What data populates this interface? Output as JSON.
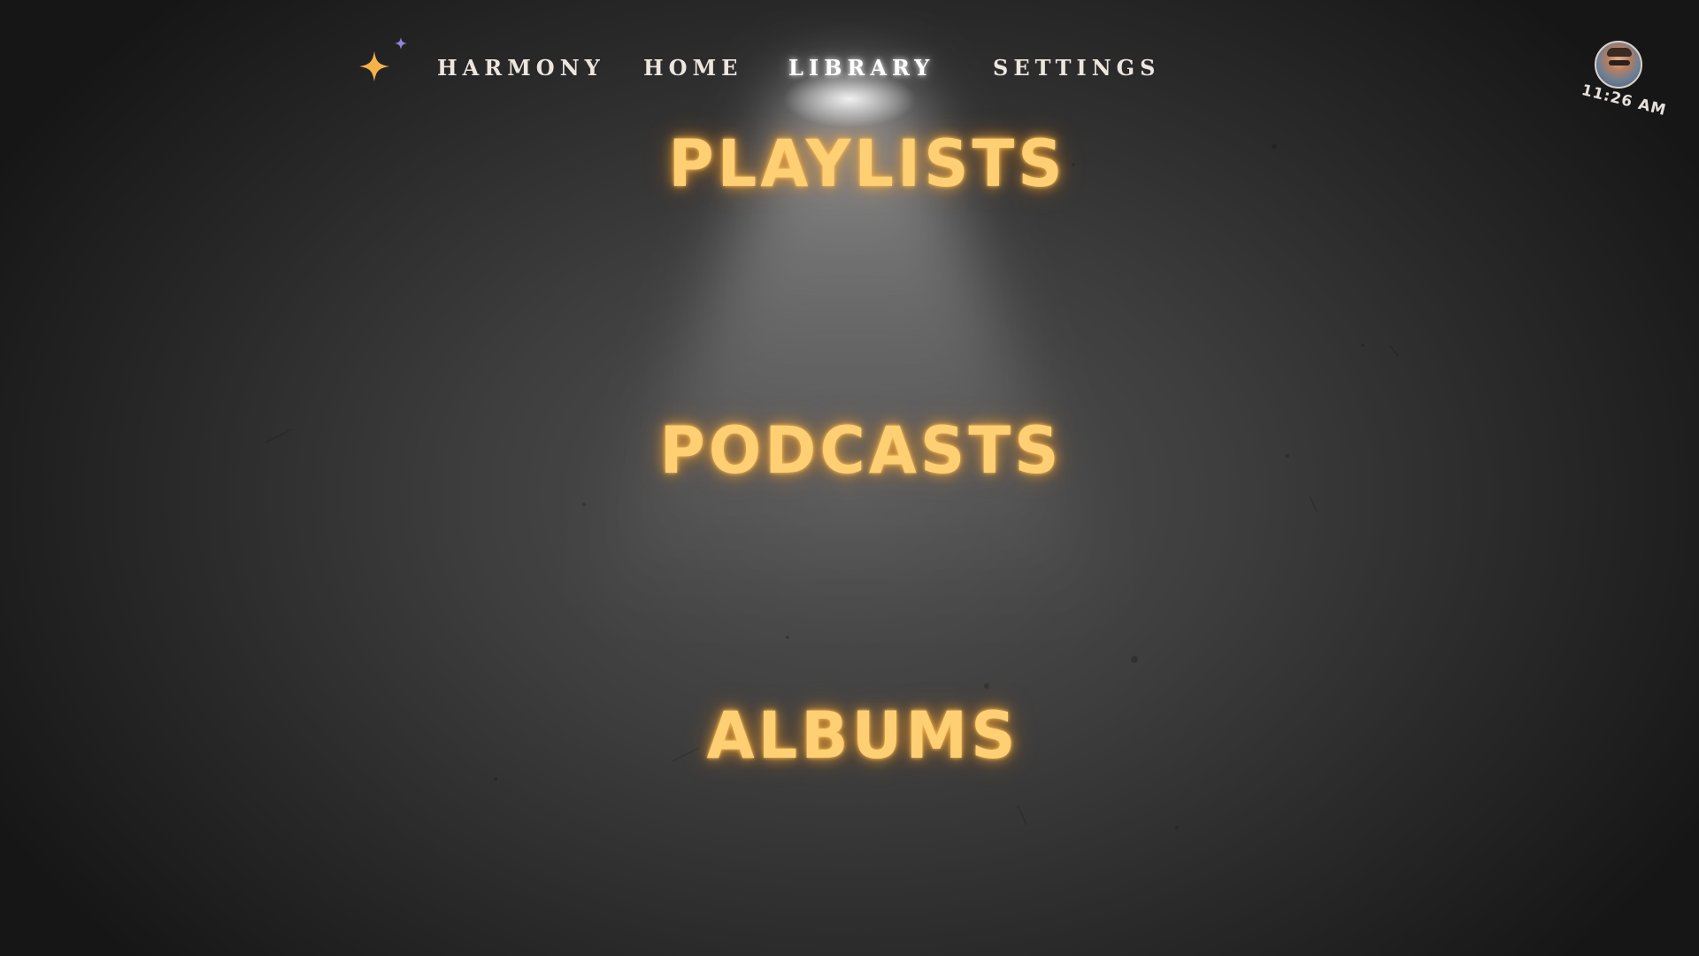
{
  "nav": {
    "logo_icon": "sparkle-star-icon",
    "brand": "HARMONY",
    "items": [
      {
        "label": "HOME"
      },
      {
        "label": "LIBRARY",
        "active": true
      },
      {
        "label": "SETTINGS"
      }
    ]
  },
  "status": {
    "avatar_icon": "user-avatar",
    "time": "11:26 AM"
  },
  "library": {
    "categories": [
      {
        "label": "PLAYLISTS"
      },
      {
        "label": "PODCASTS"
      },
      {
        "label": "ALBUMS"
      }
    ]
  },
  "colors": {
    "accent_gold": "#ffcf73",
    "star_gold": "#f5b24a",
    "star_purple": "#8f86d6",
    "nav_text": "#ece6df"
  }
}
